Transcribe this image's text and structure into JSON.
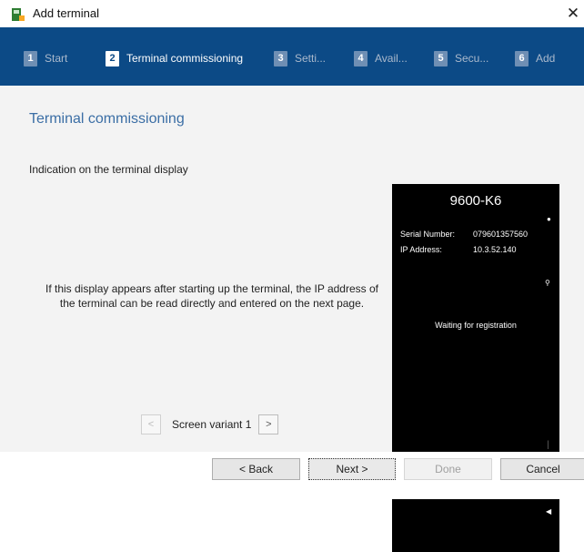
{
  "window": {
    "title": "Add terminal",
    "close_glyph": "✕"
  },
  "steps": [
    {
      "num": "1",
      "label": "Start"
    },
    {
      "num": "2",
      "label": "Terminal commissioning"
    },
    {
      "num": "3",
      "label": "Setti..."
    },
    {
      "num": "4",
      "label": "Avail..."
    },
    {
      "num": "5",
      "label": "Secu..."
    },
    {
      "num": "6",
      "label": "Add"
    }
  ],
  "active_step": 2,
  "main": {
    "title": "Terminal commissioning",
    "section_label": "Indication on the terminal display",
    "description": "If this display appears after starting up the terminal, the IP address of the terminal can be read directly and entered on the next page.",
    "variant": {
      "prev": "<",
      "label": "Screen variant 1",
      "next": ">"
    }
  },
  "terminal": {
    "model": "9600-K6",
    "serial_label": "Serial Number:",
    "serial_value": "079601357560",
    "ip_label": "IP Address:",
    "ip_value": "10.3.52.140",
    "status": "Waiting for registration"
  },
  "buttons": {
    "back": "< Back",
    "next": "Next >",
    "done": "Done",
    "cancel": "Cancel"
  },
  "colors": {
    "steps_bar": "#0c4a86",
    "title_text": "#3b6ea5",
    "content_bg": "#f3f3f3"
  },
  "icons": {
    "app": "terminal-app-icon",
    "close": "close-icon"
  }
}
